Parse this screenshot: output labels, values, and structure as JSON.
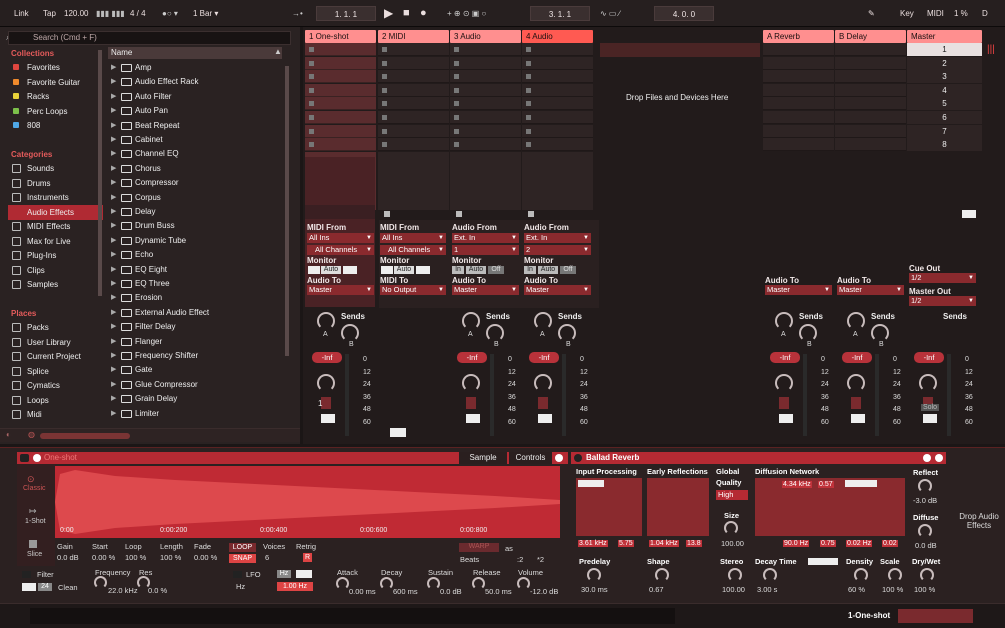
{
  "transport": {
    "link": "Link",
    "tap": "Tap",
    "tempo": "120.00",
    "signature": "4 / 4",
    "quantize": "1 Bar",
    "position": "1.   1.   1",
    "loop_start": "3.   1.   1",
    "loop_length": "4.   0.   0",
    "key": "Key",
    "midi": "MIDI",
    "cpu": "1 %",
    "d": "D"
  },
  "browser": {
    "search_placeholder": "Search (Cmd + F)",
    "collections_title": "Collections",
    "collections": [
      {
        "label": "Favorites",
        "color": "#e0463f"
      },
      {
        "label": "Favorite Guitar",
        "color": "#f08a2c"
      },
      {
        "label": "Racks",
        "color": "#e8d23a"
      },
      {
        "label": "Perc Loops",
        "color": "#7cc04a"
      },
      {
        "label": "808",
        "color": "#4fa7e6"
      }
    ],
    "categories_title": "Categories",
    "categories": [
      "Sounds",
      "Drums",
      "Instruments",
      "Audio Effects",
      "MIDI Effects",
      "Max for Live",
      "Plug-Ins",
      "Clips",
      "Samples"
    ],
    "places_title": "Places",
    "places": [
      "Packs",
      "User Library",
      "Current Project",
      "Splice",
      "Cymatics",
      "Loops",
      "Midi"
    ],
    "column_header": "Name",
    "items": [
      "Amp",
      "Audio Effect Rack",
      "Auto Filter",
      "Auto Pan",
      "Beat Repeat",
      "Cabinet",
      "Channel EQ",
      "Chorus",
      "Compressor",
      "Corpus",
      "Delay",
      "Drum Buss",
      "Dynamic Tube",
      "Echo",
      "EQ Eight",
      "EQ Three",
      "Erosion",
      "External Audio Effect",
      "Filter Delay",
      "Flanger",
      "Frequency Shifter",
      "Gate",
      "Glue Compressor",
      "Grain Delay",
      "Limiter"
    ]
  },
  "tracks": [
    {
      "name": "1 One-shot",
      "color": "#ff8f8f"
    },
    {
      "name": "2 MIDI",
      "color": "#ff8f8f"
    },
    {
      "name": "3 Audio",
      "color": "#ff8f8f"
    },
    {
      "name": "4 Audio",
      "color": "#ff5a52"
    },
    {
      "name": "A Reverb",
      "color": "#ff8f8f"
    },
    {
      "name": "B Delay",
      "color": "#ff8f8f"
    },
    {
      "name": "Master",
      "color": "#ff8f8f"
    }
  ],
  "drop_text": "Drop Files and Devices Here",
  "scenes": [
    "1",
    "2",
    "3",
    "4",
    "5",
    "6",
    "7",
    "8"
  ],
  "io": {
    "midi_from": "MIDI From",
    "audio_from": "Audio From",
    "all_ins": "All Ins",
    "all_channels": "All Channels",
    "ext_in": "Ext. In",
    "ch1": "1",
    "ch2": "2",
    "monitor": "Monitor",
    "in": "In",
    "auto": "Auto",
    "off": "Off",
    "audio_to": "Audio To",
    "midi_to": "MIDI To",
    "master": "Master",
    "no_output": "No Output",
    "cue_out": "Cue Out",
    "cue_val": "1/2",
    "master_out": "Master Out",
    "master_val": "1/2",
    "sends": "Sends",
    "a": "A",
    "b": "B",
    "inf": "-Inf",
    "solo": "Solo",
    "track1_num": "1"
  },
  "db_scale": [
    "0",
    "12",
    "24",
    "36",
    "48",
    "60"
  ],
  "sampler": {
    "title": "One-shot",
    "sample_tab": "Sample",
    "controls_tab": "Controls",
    "classic": "Classic",
    "one_shot": "1-Shot",
    "slice": "Slice",
    "times": [
      "0:00",
      "0:00:200",
      "0:00:400",
      "0:00:600",
      "0:00:800"
    ],
    "gain_label": "Gain",
    "gain": "0.0 dB",
    "start_label": "Start",
    "start": "0.00 %",
    "loop_label": "Loop",
    "loop": "100 %",
    "length_label": "Length",
    "length": "100 %",
    "fade_label": "Fade",
    "fade": "0.00 %",
    "loop_btn": "LOOP",
    "snap_btn": "SNAP",
    "voices_label": "Voices",
    "voices": "6",
    "retrig_label": "Retrig",
    "retrig": "R",
    "warp": "WARP",
    "as": "as",
    "beats": "Beats",
    "x2": ":2",
    "times2": "*2",
    "filter_label": "Filter",
    "filter_num": "24",
    "clean": "Clean",
    "frequency_label": "Frequency",
    "frequency": "22.0 kHz",
    "res_label": "Res",
    "res": "0.0 %",
    "lfo_label": "LFO",
    "hz": "Hz",
    "lfo_rate": "1.00 Hz",
    "attack_label": "Attack",
    "attack": "0.00 ms",
    "decay_label": "Decay",
    "decay": "600 ms",
    "sustain_label": "Sustain",
    "sustain": "0.0 dB",
    "release_label": "Release",
    "release": "50.0 ms",
    "volume_label": "Volume",
    "volume": "-12.0 dB"
  },
  "reverb": {
    "title": "Ballad Reverb",
    "input_processing": "Input Processing",
    "early_reflections": "Early Reflections",
    "global": "Global",
    "quality": "Quality",
    "quality_val": "High",
    "size_label": "Size",
    "size": "100.00",
    "diffusion": "Diffusion Network",
    "hz1": "3.61 kHz",
    "q1": "5.75",
    "hz2": "1.04 kHz",
    "q2": "13.8",
    "freq3": "4.34 kHz",
    "v57": "0.57",
    "hz4": "90.0 Hz",
    "v75": "0.75",
    "v02": "0.02 Hz",
    "v022": "0.02",
    "reflect_label": "Reflect",
    "reflect": "-3.0 dB",
    "diffuse_label": "Diffuse",
    "diffuse": "0.0 dB",
    "predelay_label": "Predelay",
    "predelay": "30.0 ms",
    "shape_label": "Shape",
    "shape": "0.67",
    "stereo_label": "Stereo",
    "stereo": "100.00",
    "decay_label": "Decay Time",
    "decay": "3.00 s",
    "density_label": "Density",
    "density": "60 %",
    "scale_label": "Scale",
    "scale": "100 %",
    "drywet_label": "Dry/Wet",
    "drywet": "100 %",
    "drop_audio": "Drop Audio Effects"
  },
  "status": {
    "track": "1-One-shot"
  }
}
